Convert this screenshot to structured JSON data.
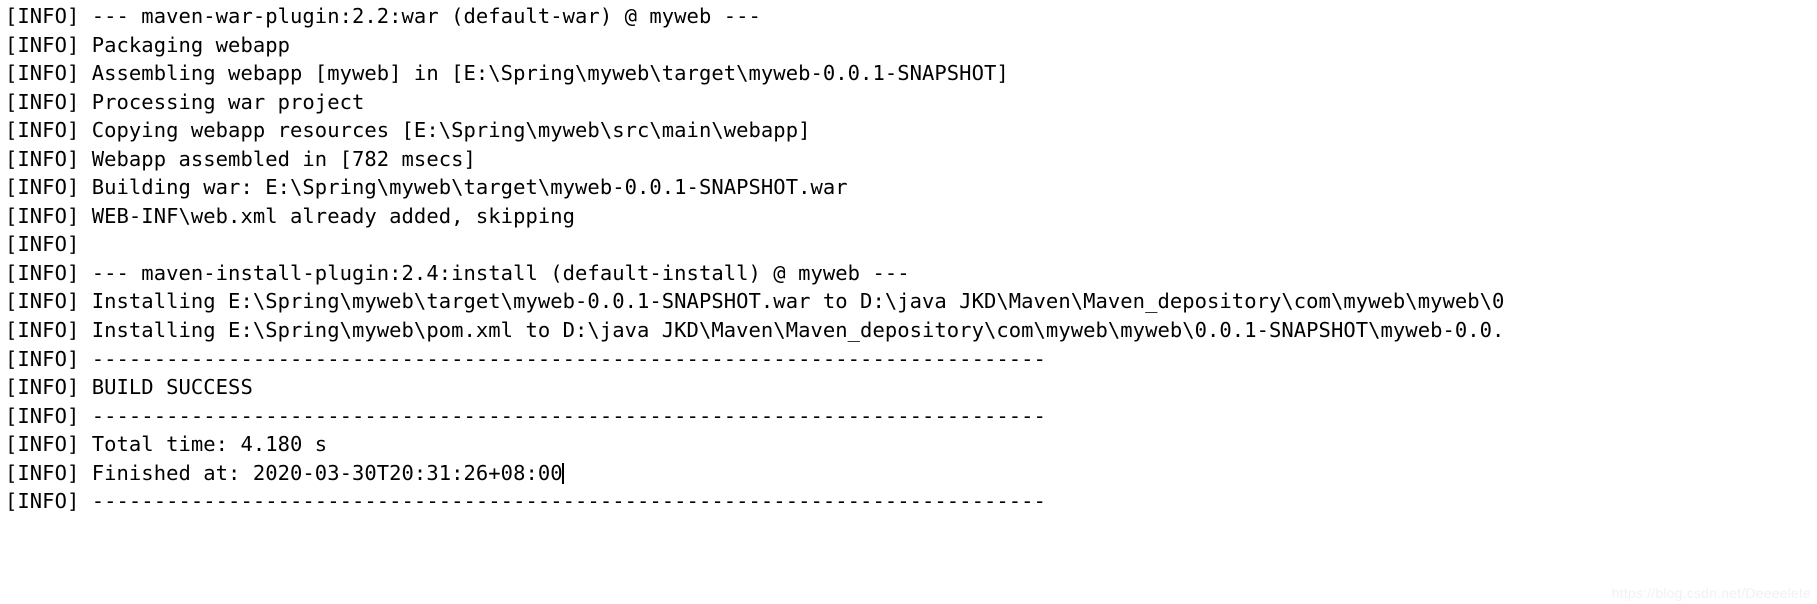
{
  "console": {
    "app": "maven-build-console",
    "background_color": "#ffffff",
    "text_color": "#000000",
    "lines": [
      {
        "text": "[INFO] --- maven-war-plugin:2.2:war (default-war) @ myweb ---",
        "caret": false
      },
      {
        "text": "[INFO] Packaging webapp",
        "caret": false
      },
      {
        "text": "[INFO] Assembling webapp [myweb] in [E:\\Spring\\myweb\\target\\myweb-0.0.1-SNAPSHOT]",
        "caret": false
      },
      {
        "text": "[INFO] Processing war project",
        "caret": false
      },
      {
        "text": "[INFO] Copying webapp resources [E:\\Spring\\myweb\\src\\main\\webapp]",
        "caret": false
      },
      {
        "text": "[INFO] Webapp assembled in [782 msecs]",
        "caret": false
      },
      {
        "text": "[INFO] Building war: E:\\Spring\\myweb\\target\\myweb-0.0.1-SNAPSHOT.war",
        "caret": false
      },
      {
        "text": "[INFO] WEB-INF\\web.xml already added, skipping",
        "caret": false
      },
      {
        "text": "[INFO] ",
        "caret": false
      },
      {
        "text": "[INFO] --- maven-install-plugin:2.4:install (default-install) @ myweb ---",
        "caret": false
      },
      {
        "text": "[INFO] Installing E:\\Spring\\myweb\\target\\myweb-0.0.1-SNAPSHOT.war to D:\\java JKD\\Maven\\Maven_depository\\com\\myweb\\myweb\\0",
        "caret": false
      },
      {
        "text": "[INFO] Installing E:\\Spring\\myweb\\pom.xml to D:\\java JKD\\Maven\\Maven_depository\\com\\myweb\\myweb\\0.0.1-SNAPSHOT\\myweb-0.0.",
        "caret": false
      },
      {
        "text": "[INFO] -----------------------------------------------------------------------------",
        "caret": false
      },
      {
        "text": "[INFO] BUILD SUCCESS",
        "caret": false
      },
      {
        "text": "[INFO] -----------------------------------------------------------------------------",
        "caret": false
      },
      {
        "text": "[INFO] Total time: 4.180 s",
        "caret": false
      },
      {
        "text": "[INFO] Finished at: 2020-03-30T20:31:26+08:00",
        "caret": true
      },
      {
        "text": "[INFO] -----------------------------------------------------------------------------",
        "caret": false
      }
    ]
  },
  "watermark": {
    "text": "https://blog.csdn.net/Deeeelete"
  }
}
